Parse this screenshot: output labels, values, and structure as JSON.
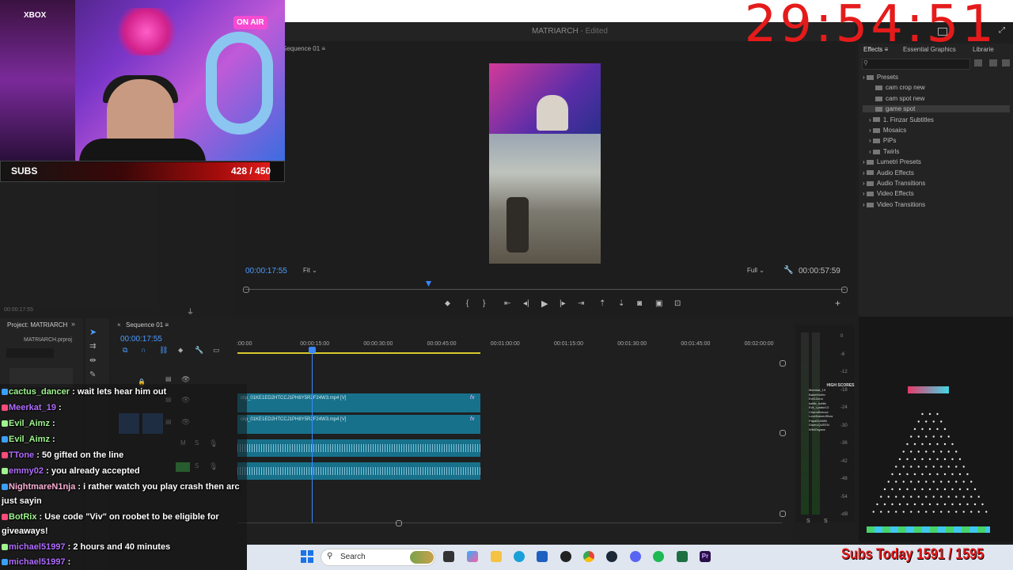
{
  "stream_overlay": {
    "timer": "29:54:51",
    "subs_label": "SUBS",
    "subs_count": "428 / 450",
    "subs_progress": 0.951,
    "webcam_xbox": "XBOX",
    "webcam_onair": "ON AIR",
    "subs_today": "Subs Today 1591 / 1595"
  },
  "premiere": {
    "project_title": "MATRIARCH",
    "edited_status": "- Edited",
    "program_sequence_tab": "Sequence 01",
    "program_timecode": "00:00:17:55",
    "fit_select": "Fit",
    "quality_select": "Full",
    "program_duration": "00:00:57:59",
    "source_timecode": "00:00:17:55",
    "project_tab": "Project: MATRIARCH",
    "project_file": "MATRIARCH.prproj",
    "timeline_tab": "Sequence 01",
    "timeline_timecode": "00:00:17:55",
    "ruler": [
      ":00:00",
      "00:00:15:00",
      "00:00:30:00",
      "00:00:45:00",
      "00:01:00:00",
      "00:01:15:00",
      "00:01:30:00",
      "00:01:45:00",
      "00:02:00:00"
    ],
    "clips": [
      "clip_01KE1ED2HTCCJ1PH8Y5R2F24W3.mp4 [V]",
      "clip_01KE1ED2HTCCJ1PH8Y5R2F24W3.mp4 [V]"
    ],
    "db_labels": [
      "0",
      "-6",
      "-12",
      "-18",
      "-24",
      "-30",
      "-36",
      "-42",
      "-48",
      "-54",
      "-dB"
    ],
    "meter_solo": [
      "S",
      "S"
    ],
    "effects_tabs": [
      "Effects",
      "Essential Graphics",
      "Librarie"
    ],
    "effects_tree": [
      {
        "label": "Presets",
        "indent": 0,
        "selected": false
      },
      {
        "label": "cam crop new",
        "indent": 2,
        "selected": false
      },
      {
        "label": "cam spot new",
        "indent": 2,
        "selected": false
      },
      {
        "label": "game spot",
        "indent": 2,
        "selected": true
      },
      {
        "label": "1. Finzar Subtitles",
        "indent": 1,
        "selected": false
      },
      {
        "label": "Mosaics",
        "indent": 1,
        "selected": false
      },
      {
        "label": "PiPs",
        "indent": 1,
        "selected": false
      },
      {
        "label": "Twirls",
        "indent": 1,
        "selected": false
      },
      {
        "label": "Lumetri Presets",
        "indent": 0,
        "selected": false
      },
      {
        "label": "Audio Effects",
        "indent": 0,
        "selected": false
      },
      {
        "label": "Audio Transitions",
        "indent": 0,
        "selected": false
      },
      {
        "label": "Video Effects",
        "indent": 0,
        "selected": false
      },
      {
        "label": "Video Transitions",
        "indent": 0,
        "selected": false
      }
    ]
  },
  "leaderboard": {
    "title": "HIGH SCORES",
    "rows": [
      "Meerkat_19",
      "BakerKnifer",
      "Evil1Zuno",
      "battle_battle",
      "Evil_Lyrake13",
      "CharmBreeze",
      "LoveNamedSlow",
      "PapaDutWilk",
      "DiamoQUEEN",
      "WildOrganz"
    ]
  },
  "chat": [
    {
      "user": "cactus_dancer",
      "color": "#9ef58e",
      "msg": "wait lets hear him out"
    },
    {
      "user": "Meerkat_19",
      "color": "#b06cff",
      "msg": ""
    },
    {
      "user": "Evil_Aimz",
      "color": "#9ef58e",
      "msg": ""
    },
    {
      "user": "Evil_Aimz",
      "color": "#9ef58e",
      "msg": ""
    },
    {
      "user": "TTone",
      "color": "#b06cff",
      "msg": "50 gifted on the line"
    },
    {
      "user": "emmy02",
      "color": "#b06cff",
      "msg": "you already accepted"
    },
    {
      "user": "NightmareN1nja",
      "color": "#ffb0d6",
      "msg": "i rather watch you play crash then arc just sayin"
    },
    {
      "user": "BotRix",
      "color": "#9ef58e",
      "msg": "Use code \"Viv\" on roobet to be eligible for giveaways!"
    },
    {
      "user": "michael51997",
      "color": "#b06cff",
      "msg": "2 hours and 40 minutes"
    },
    {
      "user": "michael51997",
      "color": "#b06cff",
      "msg": ""
    }
  ],
  "taskbar": {
    "search_placeholder": "Search"
  },
  "icons": [
    "windows-start-icon",
    "search-icon",
    "file-explorer-icon",
    "edge-icon",
    "chrome-icon",
    "steam-icon",
    "discord-icon",
    "spotify-icon",
    "excel-icon",
    "premiere-icon",
    "play-icon",
    "step-back-icon",
    "step-forward-icon",
    "export-frame-icon",
    "wrench-icon",
    "filter-icon"
  ]
}
